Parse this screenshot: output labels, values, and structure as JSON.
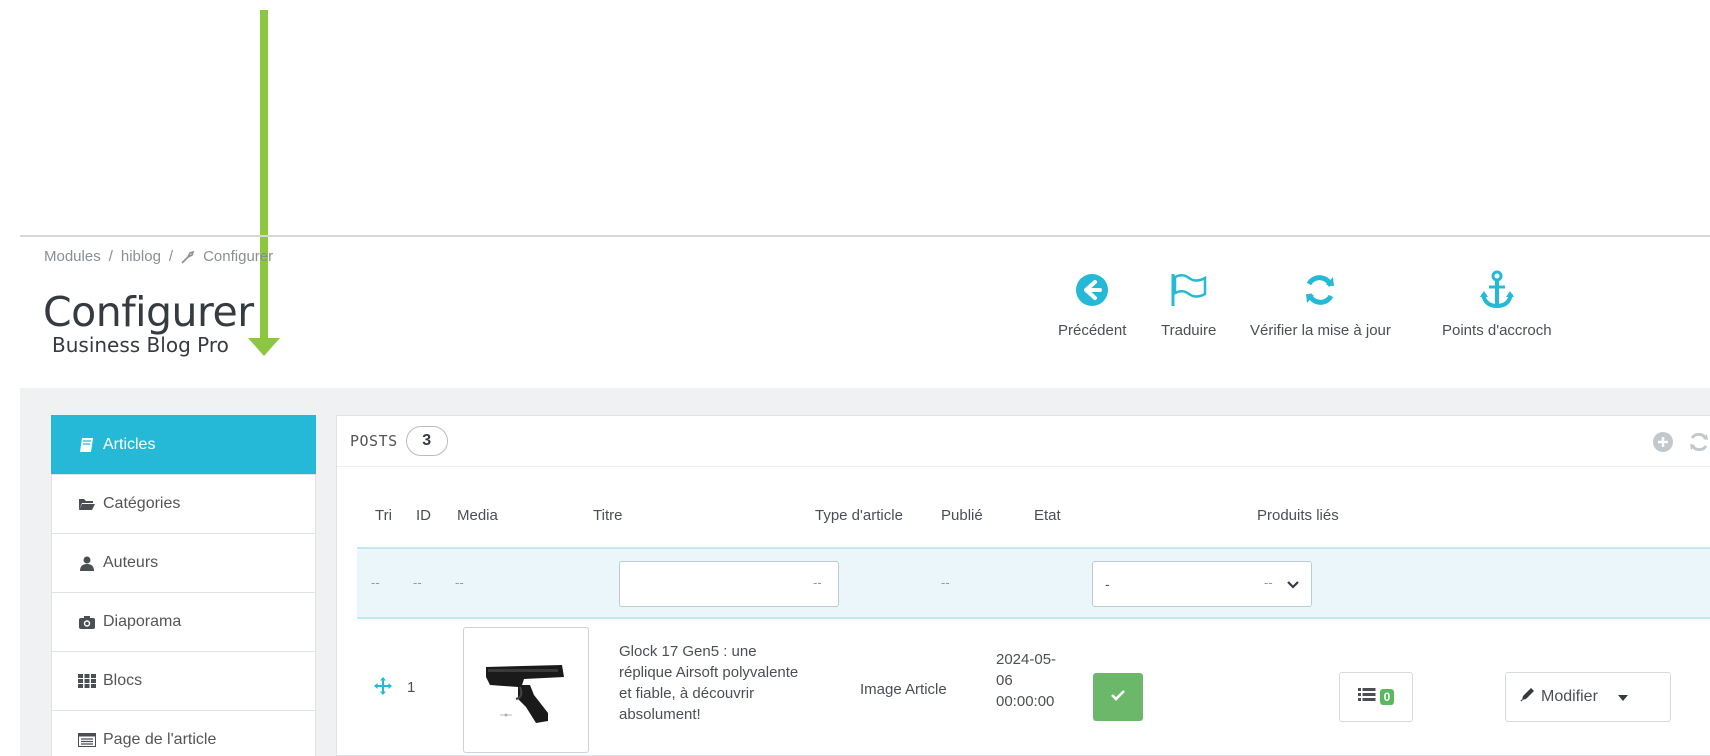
{
  "breadcrumb": {
    "items": [
      "Modules",
      "hiblog",
      "Configurer"
    ],
    "separator": "/"
  },
  "header": {
    "title": "Configurer",
    "subtitle": "Business Blog Pro"
  },
  "toolbar": {
    "buttons": [
      {
        "label": "Précédent",
        "icon": "arrow-circle-left-icon"
      },
      {
        "label": "Traduire",
        "icon": "flag-icon"
      },
      {
        "label": "Vérifier la mise à jour",
        "icon": "refresh-icon"
      },
      {
        "label": "Points d'accroch",
        "icon": "anchor-icon"
      }
    ]
  },
  "sidebar": {
    "items": [
      {
        "label": "Articles",
        "icon": "book-icon",
        "active": true
      },
      {
        "label": "Catégories",
        "icon": "folder-open-icon"
      },
      {
        "label": "Auteurs",
        "icon": "user-icon"
      },
      {
        "label": "Diaporama",
        "icon": "camera-icon"
      },
      {
        "label": "Blocs",
        "icon": "grid-icon"
      },
      {
        "label": "Page de l'article",
        "icon": "page-icon"
      }
    ]
  },
  "panel": {
    "title": "POSTS",
    "count": "3",
    "columns": [
      "Tri",
      "ID",
      "Media",
      "Titre",
      "Type d'article",
      "Publié",
      "Etat",
      "Produits liés"
    ],
    "filters": {
      "dash": "--",
      "title_value": "",
      "state_value": "-"
    },
    "rows": [
      {
        "id": "1",
        "title": "Glock 17 Gen5 : une réplique Airsoft polyvalente et fiable, à découvrir absolument!",
        "title_lines": [
          "Glock 17 Gen5 : une",
          "réplique Airsoft polyvalente",
          "et fiable, à découvrir",
          "absolument!"
        ],
        "type": "Image Article",
        "published_lines": [
          "2024-05-",
          "06",
          "00:00:00"
        ],
        "state": "enabled",
        "linked_products": "0",
        "edit_label": "Modifier"
      }
    ]
  },
  "colors": {
    "accent": "#25b9d7",
    "success": "#6cb86b",
    "annotation_arrow": "#8dc63f"
  }
}
